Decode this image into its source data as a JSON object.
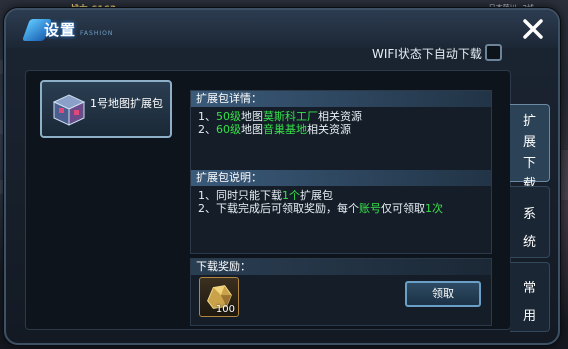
{
  "hud": {
    "power_label": "战力 6163",
    "location_label": "日本藤川~3线"
  },
  "dialog": {
    "title": "设置",
    "title_sub": "FASHION",
    "close_icon": "close-icon"
  },
  "wifi": {
    "label": "WIFI状态下自动下载",
    "checked": false
  },
  "pack_list": [
    {
      "label": "1号地图扩展包",
      "icon": "chest-icon",
      "selected": true
    }
  ],
  "details": {
    "heading": "扩展包详情：",
    "lines": [
      {
        "prefix": "1、",
        "num": "50级",
        "mid": "地图",
        "place": "莫斯科工厂",
        "suffix": "相关资源"
      },
      {
        "prefix": "2、",
        "num": "60级",
        "mid": "地图",
        "place": "音巢基地",
        "suffix": "相关资源"
      }
    ]
  },
  "instructions": {
    "heading": "扩展包说明：",
    "line1": {
      "a": "1、同时只能下载",
      "b": "1个",
      "c": "扩展包"
    },
    "line2": {
      "a": "2、下载完成后可领取奖励，每个",
      "b": "账号",
      "c": "仅可领取",
      "d": "1次"
    }
  },
  "reward": {
    "heading": "下载奖励：",
    "item_icon": "gold-ore-icon",
    "count": "100",
    "claim_label": "领取"
  },
  "side_tabs": [
    {
      "label": "扩展下载",
      "chars": [
        "扩",
        "展",
        "下",
        "载"
      ],
      "active": true
    },
    {
      "label": "系统",
      "chars": [
        "系",
        "统"
      ],
      "active": false
    },
    {
      "label": "常用",
      "chars": [
        "常",
        "用"
      ],
      "active": false
    }
  ],
  "colors": {
    "highlight_green": "#36e04a",
    "panel_header": "#3a5a7a",
    "button_border": "#6aa0c8"
  }
}
